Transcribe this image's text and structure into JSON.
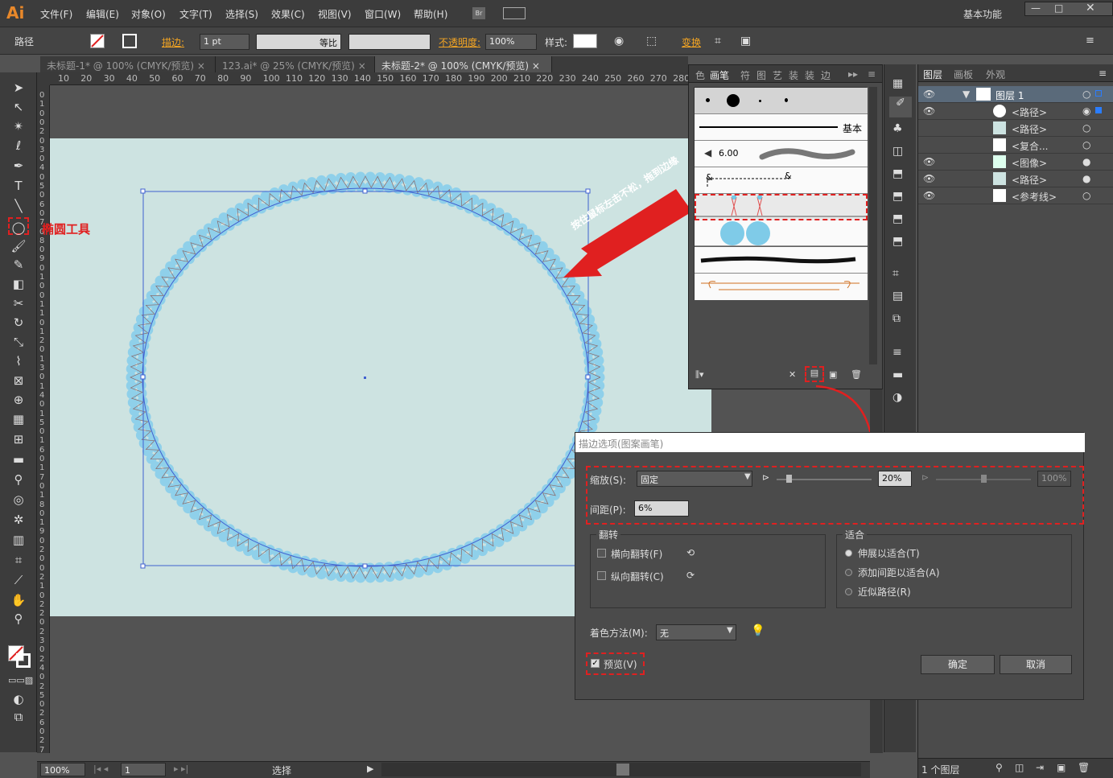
{
  "app": {
    "logo": "Ai",
    "workspace": "基本功能"
  },
  "menu": [
    "文件(F)",
    "编辑(E)",
    "对象(O)",
    "文字(T)",
    "选择(S)",
    "效果(C)",
    "视图(V)",
    "窗口(W)",
    "帮助(H)"
  ],
  "bridge_label": "Br",
  "control": {
    "selection": "路径",
    "stroke_label": "描边:",
    "stroke_value": "1 pt",
    "profile_label": "等比",
    "opacity_label": "不透明度:",
    "opacity_value": "100%",
    "style_label": "样式:",
    "transform_label": "变换"
  },
  "tabs": [
    "未标题-1* @ 100% (CMYK/预览)",
    "123.ai* @ 25% (CMYK/预览)",
    "未标题-2* @ 100% (CMYK/预览)"
  ],
  "ruler_h": [
    "10",
    "20",
    "30",
    "40",
    "50",
    "60",
    "70",
    "80",
    "90",
    "100",
    "110",
    "120",
    "130",
    "140",
    "150",
    "160",
    "170",
    "180",
    "190",
    "200",
    "210",
    "220",
    "230",
    "240",
    "250",
    "260",
    "270",
    "280"
  ],
  "ruler_v": [
    "0",
    "1",
    "0",
    "0",
    "2",
    "0",
    "3",
    "0",
    "4",
    "0",
    "5",
    "0",
    "6",
    "0",
    "7",
    "0",
    "8",
    "0",
    "9",
    "0",
    "1",
    "0",
    "0",
    "1",
    "1",
    "0",
    "1",
    "2",
    "0",
    "1",
    "3",
    "0",
    "1",
    "4",
    "0",
    "1",
    "5",
    "0",
    "1",
    "6",
    "0",
    "1",
    "7",
    "0",
    "1",
    "8",
    "0",
    "1",
    "9",
    "0",
    "2",
    "0",
    "0",
    "2",
    "1",
    "0",
    "2",
    "2",
    "0",
    "2",
    "3",
    "0",
    "2",
    "4",
    "0",
    "2",
    "5",
    "0",
    "2",
    "6",
    "0",
    "2",
    "7",
    "0"
  ],
  "annotations": {
    "ellipse_tool": "椭圆工具",
    "drag_hint": "按住鼠标左击不松，拖到边缘"
  },
  "brushes_panel": {
    "tabs": [
      "色",
      "画笔",
      "符",
      "图",
      "艺",
      "装",
      "装",
      "边"
    ],
    "basic_label": "基本",
    "size_value": "6.00"
  },
  "layers_panel": {
    "tabs": [
      "图层",
      "画板",
      "外观"
    ],
    "layer_name": "图层 1",
    "items": [
      "<路径>",
      "<路径>",
      "<复合...",
      "<图像>",
      "<路径>",
      "<参考线>"
    ],
    "count": "1 个图层"
  },
  "dialog": {
    "title": "描边选项(图案画笔)",
    "scale_label": "缩放(S):",
    "scale_value": "固定",
    "scale_min": "20%",
    "scale_max": "100%",
    "spacing_label": "间距(P):",
    "spacing_value": "6%",
    "flip_group": "翻转",
    "flip_h": "横向翻转(F)",
    "flip_v": "纵向翻转(C)",
    "fit_group": "适合",
    "fit_stretch": "伸展以适合(T)",
    "fit_space": "添加间距以适合(A)",
    "fit_approx": "近似路径(R)",
    "color_label": "着色方法(M):",
    "color_value": "无",
    "preview": "预览(V)",
    "ok": "确定",
    "cancel": "取消"
  },
  "status": {
    "zoom": "100%",
    "page": "1",
    "tool": "选择"
  },
  "colors": {
    "accent_red": "#e02020",
    "artboard": "#cde3e1",
    "bead": "#8fd0ea",
    "selection": "#4060d0"
  }
}
